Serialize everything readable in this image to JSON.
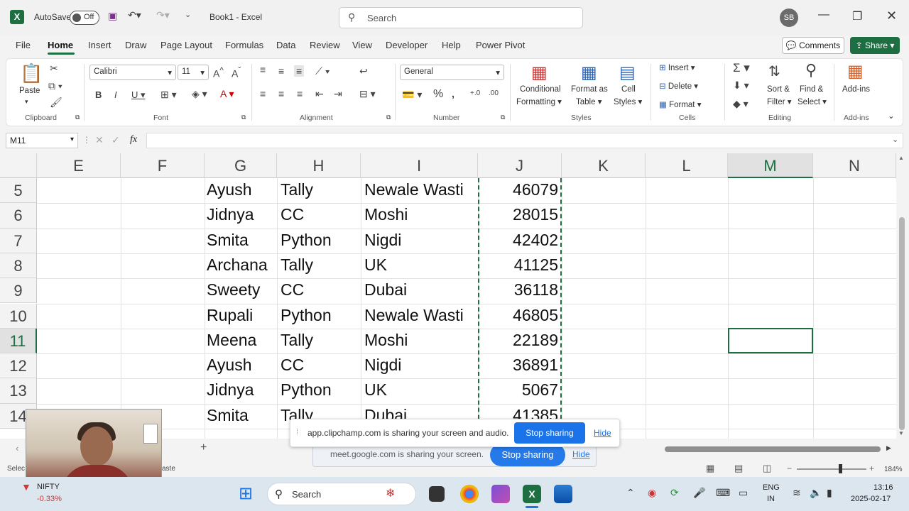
{
  "titlebar": {
    "autosave_label": "AutoSave",
    "autosave_state": "Off",
    "document_title": "Book1  -  Excel",
    "search_placeholder": "Search",
    "user_initials": "SB"
  },
  "menu": {
    "tabs": [
      "File",
      "Home",
      "Insert",
      "Draw",
      "Page Layout",
      "Formulas",
      "Data",
      "Review",
      "View",
      "Developer",
      "Help",
      "Power Pivot"
    ],
    "active_tab": "Home",
    "comments_label": "Comments",
    "share_label": "Share"
  },
  "ribbon": {
    "clipboard": {
      "paste_label": "Paste",
      "group_label": "Clipboard"
    },
    "font": {
      "font_name": "Calibri",
      "font_size": "11",
      "group_label": "Font"
    },
    "alignment": {
      "group_label": "Alignment"
    },
    "number": {
      "format": "General",
      "group_label": "Number"
    },
    "styles": {
      "conditional_formatting": [
        "Conditional",
        "Formatting"
      ],
      "format_as_table": [
        "Format as",
        "Table"
      ],
      "cell_styles": [
        "Cell",
        "Styles"
      ],
      "group_label": "Styles"
    },
    "cells": {
      "insert": "Insert",
      "delete": "Delete",
      "format": "Format",
      "group_label": "Cells"
    },
    "editing": {
      "sort_filter": [
        "Sort &",
        "Filter"
      ],
      "find_select": [
        "Find &",
        "Select"
      ],
      "group_label": "Editing"
    },
    "addins": {
      "label": "Add-ins",
      "group_label": "Add-ins"
    }
  },
  "formula_bar": {
    "name_box": "M11",
    "fx": "fx",
    "content": ""
  },
  "grid": {
    "columns": [
      "E",
      "F",
      "G",
      "H",
      "I",
      "J",
      "K",
      "L",
      "M",
      "N"
    ],
    "selected_column": "M",
    "rows": [
      {
        "num": "5",
        "G": "Ayush",
        "H": "Tally",
        "I": "Newale Wasti",
        "J": "46079"
      },
      {
        "num": "6",
        "G": "Jidnya",
        "H": "CC",
        "I": "Moshi",
        "J": "28015"
      },
      {
        "num": "7",
        "G": "Smita",
        "H": "Python",
        "I": "Nigdi",
        "J": "42402"
      },
      {
        "num": "8",
        "G": "Archana",
        "H": "Tally",
        "I": "UK",
        "J": "41125"
      },
      {
        "num": "9",
        "G": "Sweety",
        "H": "CC",
        "I": "Dubai",
        "J": "36118"
      },
      {
        "num": "10",
        "G": "Rupali",
        "H": "Python",
        "I": "Newale Wasti",
        "J": "46805"
      },
      {
        "num": "11",
        "G": "Meena",
        "H": "Tally",
        "I": "Moshi",
        "J": "22189"
      },
      {
        "num": "12",
        "G": "Ayush",
        "H": "CC",
        "I": "Nigdi",
        "J": "36891"
      },
      {
        "num": "13",
        "G": "Jidnya",
        "H": "Python",
        "I": "UK",
        "J": "5067"
      },
      {
        "num": "14",
        "G": "Smita",
        "H": "Tally",
        "I": "Dubai",
        "J": "41385"
      }
    ],
    "selected_row": "11"
  },
  "sheetbar": {
    "add_sheet": "+"
  },
  "statusbar": {
    "left_text_1": "Selec",
    "left_text_2": "aste",
    "zoom": "184%"
  },
  "share_banners": {
    "clipchamp": {
      "text": "app.clipchamp.com is sharing your screen and audio.",
      "stop": "Stop sharing",
      "hide": "Hide"
    },
    "meet": {
      "text": "meet.google.com is sharing your screen.",
      "stop": "Stop sharing",
      "hide": "Hide"
    }
  },
  "taskbar": {
    "ticker_name": "NIFTY",
    "ticker_change": "-0.33%",
    "search_label": "Search",
    "language": [
      "ENG",
      "IN"
    ],
    "time": "13:16",
    "date": "2025-02-17"
  },
  "colors": {
    "excel_green": "#1d6f42",
    "meet_blue": "#1a73e8"
  }
}
